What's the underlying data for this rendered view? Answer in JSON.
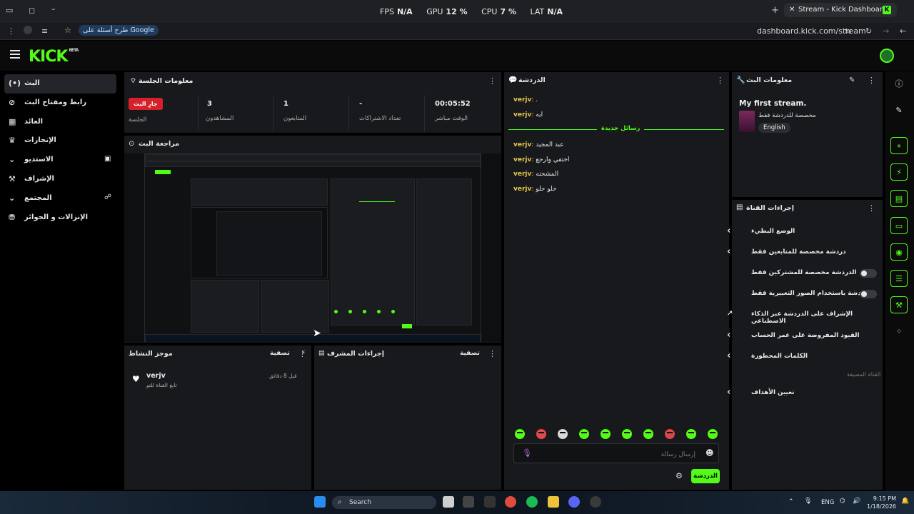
{
  "browser": {
    "tab_title": "Stream - Kick Dashboard",
    "url": "dashboard.kick.com/stream",
    "google_button": "طرح أسئلة على Google",
    "stats": [
      {
        "label": "FPS",
        "value": "N/A"
      },
      {
        "label": "GPU",
        "value": "12 %"
      },
      {
        "label": "CPU",
        "value": "7 %"
      },
      {
        "label": "LAT",
        "value": "N/A"
      }
    ]
  },
  "brand": {
    "logo": "KICK",
    "badge": "BETA"
  },
  "nav": [
    {
      "label": "البث",
      "icon": "live-icon",
      "active": true
    },
    {
      "label": "رابط ومفتاح البث",
      "icon": "link-icon"
    },
    {
      "label": "العائد",
      "icon": "revenue-icon"
    },
    {
      "label": "الإنجازات",
      "icon": "trophy-icon"
    },
    {
      "label": "الاستديو",
      "icon": "studio-icon",
      "expandable": true
    },
    {
      "label": "الإشراف",
      "icon": "moderation-icon"
    },
    {
      "label": "المجتمع",
      "icon": "community-icon",
      "expandable": true
    },
    {
      "label": "الإنزالات و الجوائز",
      "icon": "drops-icon"
    }
  ],
  "session": {
    "title": "معلومات الجلسة",
    "live_badge": "جارِ البث",
    "session_label": "الجلسة",
    "stats": [
      {
        "value": "3",
        "label": "المشاهدون"
      },
      {
        "value": "1",
        "label": "المتابعون"
      },
      {
        "value": "-",
        "label": "تعداد الاشتراكات"
      },
      {
        "value": "00:05:52",
        "label": "الوقت مباشر"
      }
    ]
  },
  "preview": {
    "title": "مراجعة البث"
  },
  "activity": {
    "title": "موجز النشاط",
    "filter": "تصفية",
    "items": [
      {
        "user": "verjv",
        "text": "تابع القناة للتو",
        "time": "قبل 8 دقائق"
      }
    ]
  },
  "mod_actions": {
    "title": "إجراءات المشرف",
    "filter": "تصفية"
  },
  "chat": {
    "title": "الدردشة",
    "new_messages": "رسائل جديدة",
    "messages_before": [
      {
        "user": "verjv",
        "text": "."
      },
      {
        "user": "verjv",
        "text": "ايه"
      }
    ],
    "messages_after": [
      {
        "user": "verjv",
        "text": "عبد المجيد"
      },
      {
        "user": "verjv",
        "text": "اختفي وارجع"
      },
      {
        "user": "verjv",
        "text": "المشحنه"
      },
      {
        "user": "verjv",
        "text": "حلو حلو"
      }
    ],
    "input_placeholder": "إرسال رسالة",
    "send_button": "الدردشة"
  },
  "stream_info": {
    "title": "معلومات البث",
    "stream_title": "My first stream.",
    "category": "مخصصة للدردشة فقط",
    "language": "English"
  },
  "channel_actions": {
    "title": "إجراءات القناة",
    "rows": [
      {
        "label": "الوضع البطيء",
        "control": "chevron"
      },
      {
        "label": "دردشة مخصصة للمتابعين فقط",
        "control": "chevron"
      },
      {
        "label": "الدردشة مخصصة للمشتركين فقط",
        "control": "toggle",
        "on": false
      },
      {
        "label": "الدردشة باستخدام الصور التعبيرية فقط",
        "control": "toggle",
        "on": false
      },
      {
        "label": "الإشراف على الدردشة عبر الذكاء الاصطناعي",
        "control": "external"
      },
      {
        "label": "القيود المفروضة على عمر الحساب",
        "control": "chevron"
      },
      {
        "label": "الكلمات المحظورة",
        "control": "chevron"
      }
    ],
    "featured_channel": "القناة المضيفة",
    "goals": "تعيين الأهداف"
  },
  "taskbar": {
    "search": "Search",
    "lang": "ENG",
    "time": "9:15 PM",
    "date": "1/18/2026"
  },
  "colors": {
    "accent": "#53fc18",
    "live": "#d6212b",
    "panel": "#18191c"
  }
}
